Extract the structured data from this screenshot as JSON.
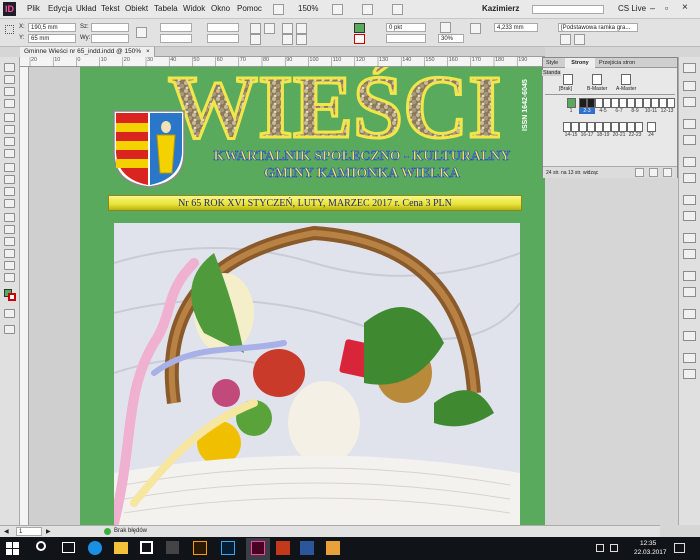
{
  "menubar": {
    "logo": "ID",
    "items": [
      "Plik",
      "Edycja",
      "Układ",
      "Tekst",
      "Obiekt",
      "Tabela",
      "Widok",
      "Okno",
      "Pomoc"
    ],
    "zoom": "150%",
    "user": "Kazimierz",
    "cs_live": "CS Live"
  },
  "control": {
    "x_label": "X:",
    "x_value": "190,5 mm",
    "y_label": "Y:",
    "y_value": "65 mm",
    "w_label": "Sz:",
    "h_label": "Wy:",
    "stroke_weight": "0 pkt",
    "opacity": "30%",
    "size_value": "4,233 mm",
    "frame_style": "[Podstawowa ramka gra..."
  },
  "document_tab": {
    "title": "Gminne Wieści nr 65_indd.indd @ 150%",
    "close": "×"
  },
  "ruler": {
    "h_ticks": [
      "20",
      "10",
      "0",
      "10",
      "20",
      "30",
      "40",
      "50",
      "60",
      "70",
      "80",
      "90",
      "100",
      "110",
      "120",
      "130",
      "140",
      "150",
      "160",
      "170",
      "180",
      "190"
    ]
  },
  "page": {
    "masthead": "WIEŚCI",
    "issn": "ISSN 1642-6045",
    "subtitle_line1": "KWARTALNIK SPOŁECZNO - KULTURALNY",
    "subtitle_line2": "GMINY KAMIONKA WIELKA",
    "issue_line": "Nr 65   ROK   XVI   STYCZEŃ,   LUTY,   MARZEC 2017 r.   Cena 3 PLN"
  },
  "pages_panel": {
    "tabs": [
      "Style",
      "Strony",
      "Przejścia stron"
    ],
    "side_label": "Standa",
    "masters": [
      "[Brak]",
      "B-Master",
      "A-Master"
    ],
    "spreads": [
      [
        "1"
      ],
      [
        "2-3"
      ],
      [
        "4-5"
      ],
      [
        "6-7"
      ],
      [
        "8-9"
      ],
      [
        "10-11"
      ],
      [
        "12-13"
      ],
      [
        "14-15"
      ],
      [
        "16-17"
      ],
      [
        "18-19"
      ],
      [
        "20-21"
      ],
      [
        "22-23"
      ],
      [
        "24"
      ]
    ],
    "footer": "24 str. na 13 str. widząc"
  },
  "status": {
    "page_field": "1",
    "preflight": "Brak błędów"
  },
  "taskbar": {
    "time": "12:35",
    "date": "22.03.2017"
  },
  "colors": {
    "page_green": "#5aaa5e",
    "masthead_yellow": "#f2e64a",
    "banner_yellow": "#e8e233",
    "subtitle_blue": "#1d3fd6"
  }
}
